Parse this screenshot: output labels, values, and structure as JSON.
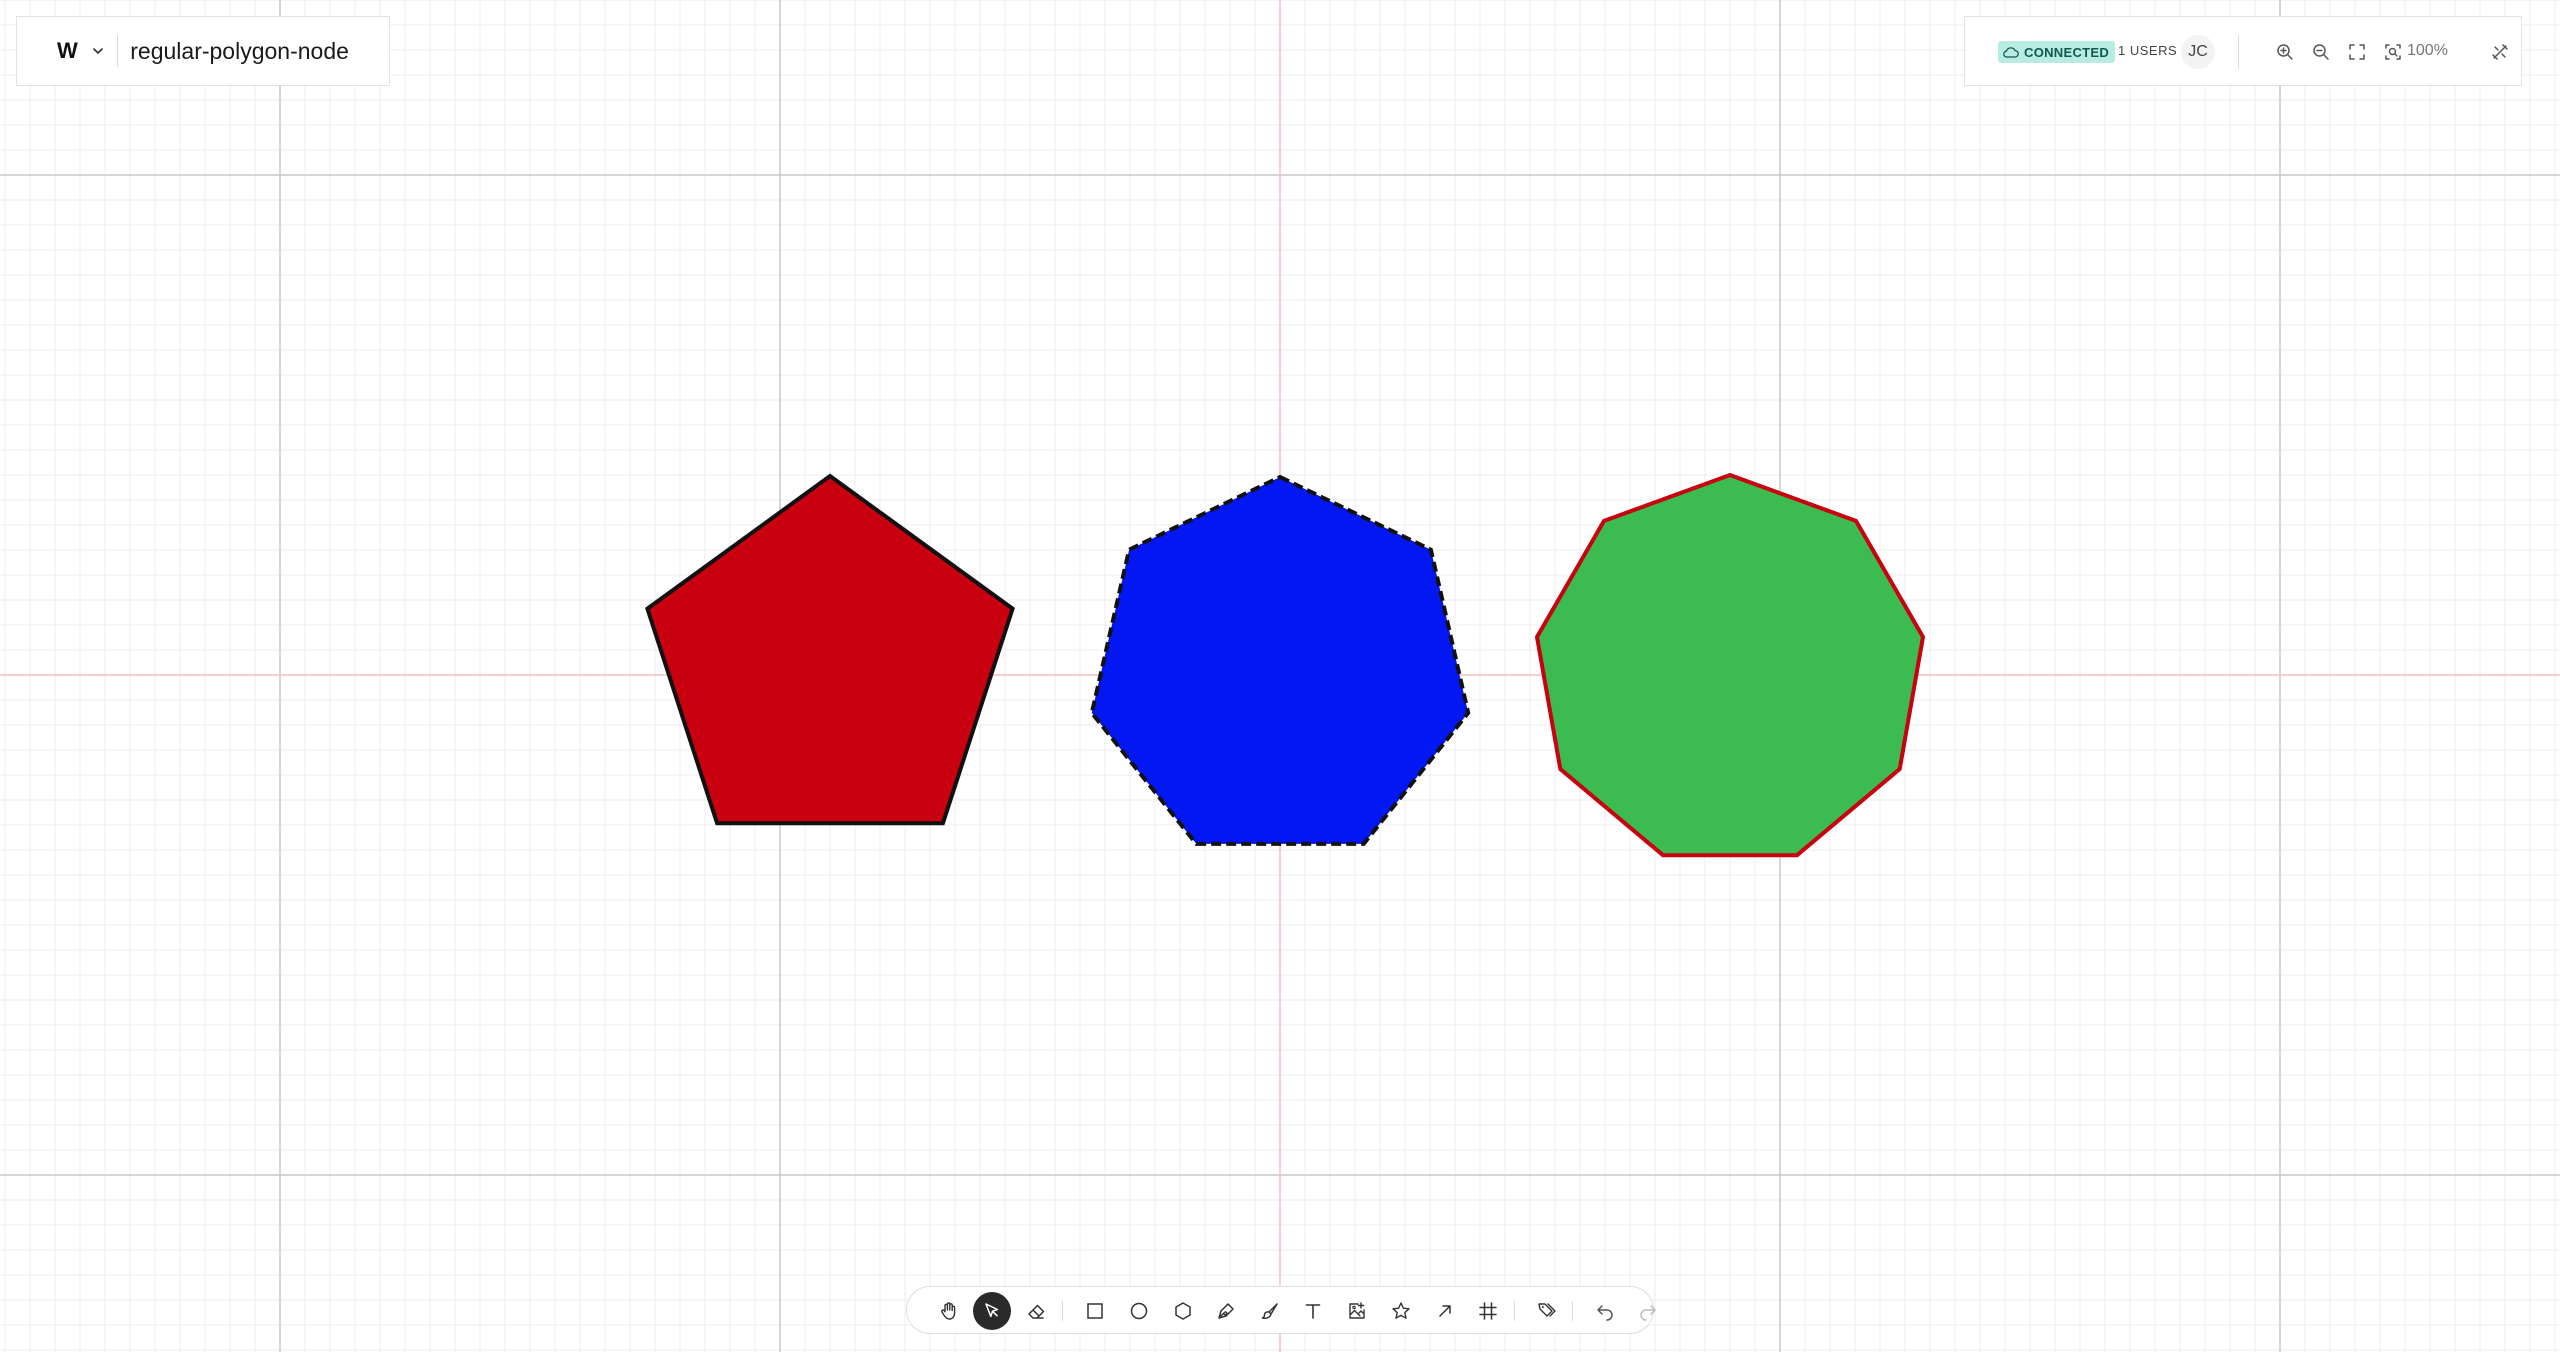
{
  "document": {
    "logo": "W",
    "title": "regular-polygon-node"
  },
  "status": {
    "connection": "CONNECTED",
    "users": "1 USERS",
    "avatar_initials": "JC",
    "zoom": "100%"
  },
  "header_icons": [
    "zoom-in-icon",
    "zoom-out-icon",
    "fit-screen-icon",
    "zoom-to-selection-icon",
    "settings-tools-icon"
  ],
  "toolbar": {
    "tools": [
      {
        "name": "hand-tool",
        "icon": "hand-icon",
        "active": false
      },
      {
        "name": "select-tool",
        "icon": "cursor-icon",
        "active": true
      },
      {
        "name": "eraser-tool",
        "icon": "eraser-icon",
        "active": false
      },
      {
        "name": "rectangle-tool",
        "icon": "square-icon",
        "active": false
      },
      {
        "name": "ellipse-tool",
        "icon": "circle-icon",
        "active": false
      },
      {
        "name": "polygon-tool",
        "icon": "hexagon-icon",
        "active": false
      },
      {
        "name": "pen-tool",
        "icon": "pen-icon",
        "active": false
      },
      {
        "name": "brush-tool",
        "icon": "brush-icon",
        "active": false
      },
      {
        "name": "text-tool",
        "icon": "text-icon",
        "active": false
      },
      {
        "name": "image-tool",
        "icon": "image-icon",
        "active": false
      },
      {
        "name": "star-tool",
        "icon": "star-icon",
        "active": false
      },
      {
        "name": "arrow-tool",
        "icon": "arrow-icon",
        "active": false
      },
      {
        "name": "frame-tool",
        "icon": "frame-icon",
        "active": false
      },
      {
        "name": "tag-tool",
        "icon": "tags-icon",
        "active": false
      },
      {
        "name": "undo-button",
        "icon": "undo-icon",
        "active": false
      },
      {
        "name": "redo-button",
        "icon": "redo-icon",
        "active": false
      }
    ]
  },
  "shapes": [
    {
      "name": "pentagon-shape",
      "sides": 5,
      "fill": "#c8000f",
      "stroke": "#111111",
      "dashed": false
    },
    {
      "name": "heptagon-shape",
      "sides": 7,
      "fill": "#0317f3",
      "stroke": "#111111",
      "dashed": true
    },
    {
      "name": "nonagon-shape",
      "sides": 9,
      "fill": "#3bbb50",
      "stroke": "#c8000f",
      "dashed": false
    }
  ],
  "colors": {
    "grid_minor": "#ececec",
    "grid_major": "#c9c9c9",
    "axis": "#f4c1c1",
    "badge_bg": "#b8ece3",
    "active_tool": "#2a2a2a"
  }
}
